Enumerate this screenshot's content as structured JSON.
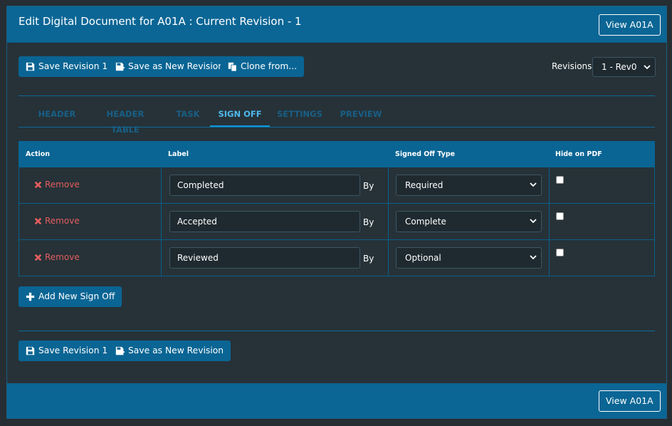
{
  "header": {
    "title": "Edit Digital Document for A01A : Current Revision - 1",
    "view_button": "View A01A"
  },
  "toolbar": {
    "save_revision": "Save Revision 1",
    "save_new_revision": "Save as New Revision",
    "clone_from": "Clone from...",
    "revisions_label": "Revisions:",
    "revisions_selected": "1 - Rev0"
  },
  "tabs": [
    {
      "label": "HEADER",
      "active": false
    },
    {
      "label": "HEADER TABLE",
      "active": false
    },
    {
      "label": "TASK",
      "active": false
    },
    {
      "label": "SIGN OFF",
      "active": true
    },
    {
      "label": "SETTINGS",
      "active": false
    },
    {
      "label": "PREVIEW",
      "active": false
    }
  ],
  "table": {
    "columns": [
      "Action",
      "Label",
      "Signed Off Type",
      "Hide on PDF"
    ],
    "rows": [
      {
        "action": "Remove",
        "label": "Completed",
        "by": "By",
        "type": "Required",
        "hide": false
      },
      {
        "action": "Remove",
        "label": "Accepted",
        "by": "By",
        "type": "Complete",
        "hide": false
      },
      {
        "action": "Remove",
        "label": "Reviewed",
        "by": "By",
        "type": "Optional",
        "hide": false
      }
    ]
  },
  "add_button": "Add New Sign Off",
  "footer": {
    "save_revision": "Save Revision 1",
    "save_new_revision": "Save as New Revision",
    "view_button": "View A01A"
  },
  "colors": {
    "header_bg": "#0b6695",
    "panel_bg": "#263238",
    "remove": "#e35d5d",
    "tab_active": "#4fb8ec",
    "tab_inactive": "#185f86"
  }
}
